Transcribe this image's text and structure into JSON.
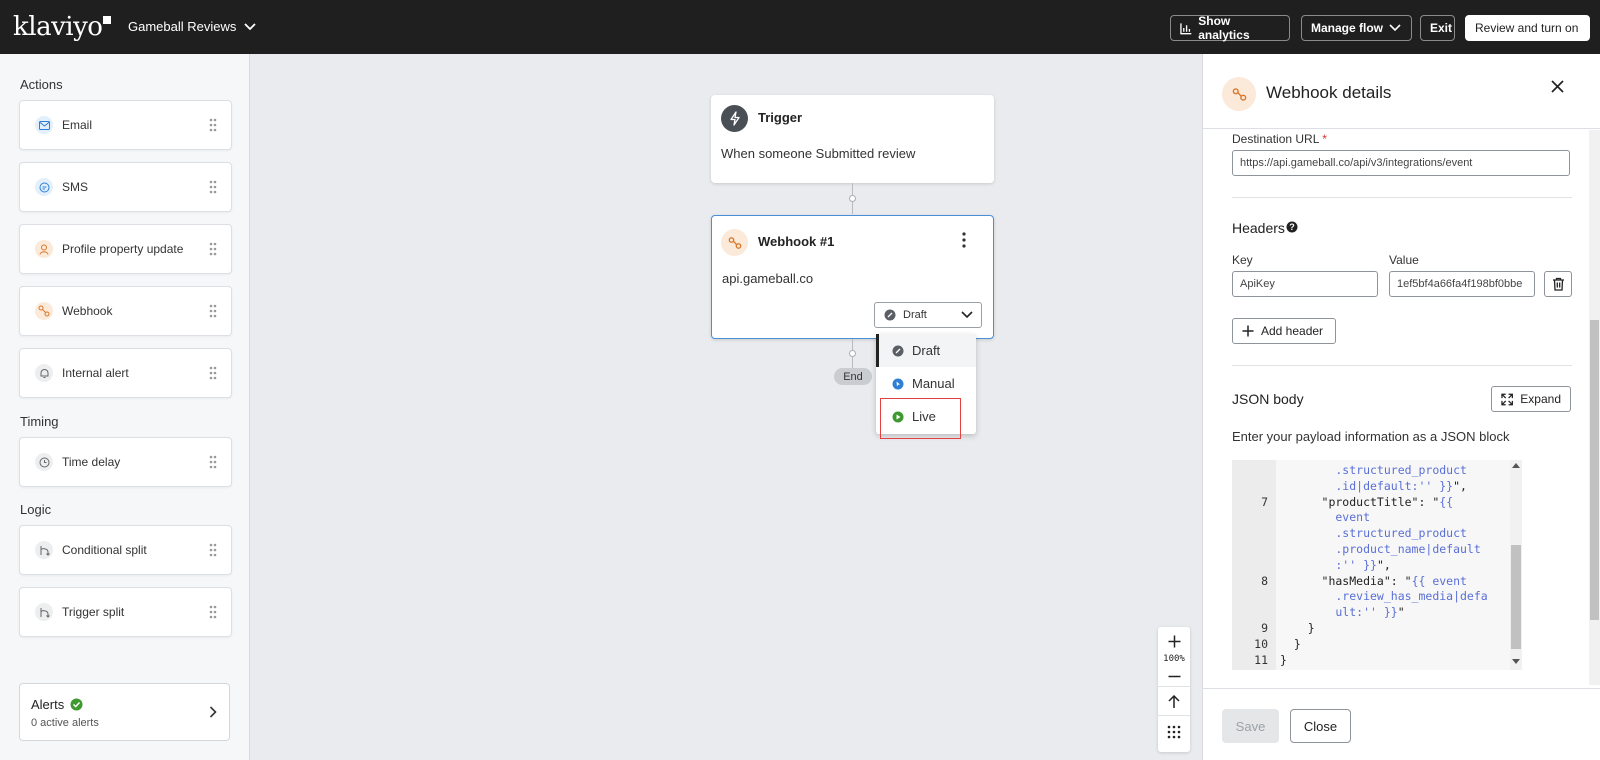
{
  "topbar": {
    "logo": "klaviyo",
    "flow_name": "Gameball Reviews",
    "show_analytics": "Show analytics",
    "manage_flow": "Manage flow",
    "exit": "Exit",
    "review_turn_on": "Review and turn on"
  },
  "sidebar": {
    "actions_title": "Actions",
    "actions": [
      {
        "label": "Email",
        "icon": "email-icon"
      },
      {
        "label": "SMS",
        "icon": "sms-icon"
      },
      {
        "label": "Profile property update",
        "icon": "profile-icon"
      },
      {
        "label": "Webhook",
        "icon": "webhook-icon"
      },
      {
        "label": "Internal alert",
        "icon": "bell-icon"
      }
    ],
    "timing_title": "Timing",
    "timing": [
      {
        "label": "Time delay",
        "icon": "clock-icon"
      }
    ],
    "logic_title": "Logic",
    "logic": [
      {
        "label": "Conditional split",
        "icon": "split-icon"
      },
      {
        "label": "Trigger split",
        "icon": "split-icon"
      }
    ],
    "alerts": {
      "title": "Alerts",
      "subtitle": "0 active alerts"
    }
  },
  "canvas": {
    "trigger": {
      "title": "Trigger",
      "text": "When someone Submitted review"
    },
    "webhook": {
      "title": "Webhook #1",
      "text": "api.gameball.co",
      "status": "Draft"
    },
    "end_label": "End",
    "status_options": [
      "Draft",
      "Manual",
      "Live"
    ],
    "status_colors": {
      "draft": "#5a5f66",
      "manual": "#2f7fd4",
      "live": "#3e9a2f"
    },
    "zoom": "100%"
  },
  "panel": {
    "title": "Webhook details",
    "destination_label": "Destination URL",
    "destination_value": "https://api.gameball.co/api/v3/integrations/event",
    "headers_title": "Headers",
    "key_label": "Key",
    "value_label": "Value",
    "header_key": "ApiKey",
    "header_value": "1ef5bf4a66fa4f198bf0bbe",
    "add_header": "Add header",
    "json_title": "JSON body",
    "expand": "Expand",
    "json_hint": "Enter your payload information as a JSON block",
    "code_lines": [
      {
        "num": "",
        "segments": [
          [
            "        .structured_product",
            "tpl"
          ]
        ]
      },
      {
        "num": "",
        "segments": [
          [
            "        .id|default:'' }}",
            "tpl"
          ],
          [
            "\",",
            "plain"
          ]
        ]
      },
      {
        "num": "7",
        "segments": [
          [
            "      \"productTitle\": \"",
            "plain"
          ],
          [
            "{{",
            "tpl"
          ]
        ]
      },
      {
        "num": "",
        "segments": [
          [
            "        event",
            "tpl"
          ]
        ]
      },
      {
        "num": "",
        "segments": [
          [
            "        .structured_product",
            "tpl"
          ]
        ]
      },
      {
        "num": "",
        "segments": [
          [
            "        .product_name|default",
            "tpl"
          ]
        ]
      },
      {
        "num": "",
        "segments": [
          [
            "        :'' }}",
            "tpl"
          ],
          [
            "\",",
            "plain"
          ]
        ]
      },
      {
        "num": "8",
        "segments": [
          [
            "      \"hasMedia\": \"",
            "plain"
          ],
          [
            "{{ event",
            "tpl"
          ]
        ]
      },
      {
        "num": "",
        "segments": [
          [
            "        .review_has_media|defa",
            "tpl"
          ]
        ]
      },
      {
        "num": "",
        "segments": [
          [
            "        ult:'' }}",
            "tpl"
          ],
          [
            "\"",
            "plain"
          ]
        ]
      },
      {
        "num": "9",
        "segments": [
          [
            "    }",
            "plain"
          ]
        ]
      },
      {
        "num": "10",
        "segments": [
          [
            "  }",
            "plain"
          ]
        ]
      },
      {
        "num": "11",
        "segments": [
          [
            "}",
            "plain"
          ]
        ]
      }
    ],
    "save": "Save",
    "close": "Close"
  }
}
